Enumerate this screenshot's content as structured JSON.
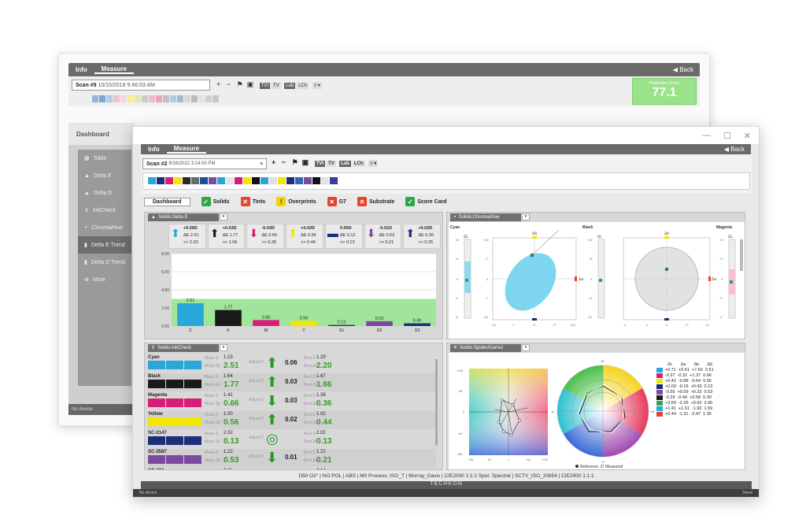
{
  "back_window": {
    "tabs": [
      "Info",
      "Measure"
    ],
    "back_label": "Back",
    "scan_label": "Scan #9",
    "scan_time": "10/15/2018 9:46:53 AM",
    "toolbar": [
      "+",
      "−",
      "TVI",
      "TV",
      "Lab",
      "LCh"
    ],
    "production_score_label": "Production Score",
    "production_score_value": "77.1",
    "dashboard_label": "Dashboard",
    "sidebar": [
      "Table",
      "Delta E",
      "Delta D",
      "InkCheck",
      "Chroma/Hue",
      "Delta E Trend",
      "Delta D Trend",
      "More"
    ],
    "status": "No device",
    "swatch_colors": [
      "#9ab4d8",
      "#7fa7d6",
      "#b6c9e6",
      "#f0c0d4",
      "#f4d6e2",
      "#f6ed9a",
      "#dfe9a8",
      "#c9c9c9",
      "#f2b9cc",
      "#e8a6bc",
      "#c0c0c0",
      "#b6c7e4",
      "#a8b8d8",
      "#d7d7d7",
      "#bcbcbc",
      "#e4e4e4",
      "#d0d0d0",
      "#c8c8c8"
    ]
  },
  "front_window": {
    "tabs": [
      "Info",
      "Measure"
    ],
    "back_label": "Back",
    "scan_label": "Scan #2",
    "scan_time": "8/16/2022 3:24:00 PM",
    "toolbar": [
      "+",
      "−",
      "TVI",
      "TV",
      "Lab",
      "LCh"
    ],
    "swatch_colors": [
      "#29a7d8",
      "#1c2e78",
      "#d61e78",
      "#f3e600",
      "#2a2a2a",
      "#6a6a6a",
      "#1a4f9c",
      "#7c4ba0",
      "#29a7d8",
      "#e3e3e3",
      "#d61e78",
      "#f3e600",
      "#111",
      "#29a7d8",
      "#e0e0e0",
      "#f3e600",
      "#1c2e78",
      "#2e6ab3",
      "#7c4ba0",
      "#111",
      "#e2e2e2",
      "#3a3aa0"
    ],
    "dash_tabs": [
      {
        "label": "Dashboard",
        "status": "none"
      },
      {
        "label": "Solids",
        "status": "ok"
      },
      {
        "label": "Tints",
        "status": "err"
      },
      {
        "label": "Overprints",
        "status": "warn"
      },
      {
        "label": "G7",
        "status": "err"
      },
      {
        "label": "Substrate",
        "status": "err"
      },
      {
        "label": "Score Card",
        "status": "ok"
      }
    ],
    "panels": {
      "delta_e_title": "Solids:Delta E",
      "chroma_title": "Solids:Chroma/Hue",
      "inkcheck_title": "Solids:InkCheck",
      "spider_title": "Solids:Spider/Gamut"
    },
    "delta_tiles": [
      {
        "d": "+0.06D",
        "de": "ΔE 2.51",
        "t": ">> 2.20",
        "color": "#29a7d8",
        "dir": "up"
      },
      {
        "d": "+0.03D",
        "de": "ΔE 1.77",
        "t": ">> 1.66",
        "color": "#1a1a1a",
        "dir": "up"
      },
      {
        "d": "-0.03D",
        "de": "ΔE 0.66",
        "t": ">> 0.36",
        "color": "#d61e78",
        "dir": "down"
      },
      {
        "d": "+0.02D",
        "de": "ΔE 0.56",
        "t": ">> 0.44",
        "color": "#f3e600",
        "dir": "up"
      },
      {
        "d": "0.00D",
        "de": "ΔE 0.12",
        "t": ">> 0.13",
        "color": "#1c2e78",
        "dir": "none"
      },
      {
        "d": "-0.01D",
        "de": "ΔE 0.53",
        "t": ">> 0.21",
        "color": "#7c4ba0",
        "dir": "down"
      },
      {
        "d": "+0.03D",
        "de": "ΔE 0.30",
        "t": ">> 0.26",
        "color": "#1c2e78",
        "dir": "up"
      }
    ],
    "chroma": {
      "labels": [
        "Cyan",
        "Black",
        "Magenta"
      ],
      "left_ticks": [
        "+14",
        "+7",
        "0",
        "-7",
        "-14"
      ],
      "bottom_ticks_1": [
        "-14",
        "-7",
        "0",
        "+7",
        "+14"
      ],
      "bottom_ticks_2": [
        "-4",
        "-2",
        "0",
        "+2",
        "+4"
      ],
      "side_ticks_1": [
        "+8",
        "+4",
        "0",
        "-4",
        "-8"
      ],
      "side_ticks_2": [
        "+12",
        "+6",
        "0",
        "-6",
        "-12"
      ],
      "side_ticks_3": [
        "+4",
        "+2",
        "0",
        "-2",
        "-4"
      ],
      "dl": "ΔL",
      "db": "Δb",
      "da": "Δa"
    },
    "inkcheck": [
      {
        "name": "Cyan",
        "colors": [
          "#29a7d8",
          "#29a7d8",
          "#29a7d8"
        ],
        "meas_d": "1.23",
        "meas_de": "2.51",
        "adjust": "0.06",
        "dir": "up",
        "best_d": "1.29",
        "best_de": "2.20"
      },
      {
        "name": "Black",
        "colors": [
          "#1a1a1a",
          "#1a1a1a",
          "#1a1a1a"
        ],
        "meas_d": "1.64",
        "meas_de": "1.77",
        "adjust": "0.03",
        "dir": "up",
        "best_d": "1.67",
        "best_de": "1.66"
      },
      {
        "name": "Magenta",
        "colors": [
          "#d61e78",
          "#d61e78",
          "#d61e78"
        ],
        "meas_d": "1.41",
        "meas_de": "0.66",
        "adjust": "0.03",
        "dir": "down",
        "best_d": "1.38",
        "best_de": "0.36"
      },
      {
        "name": "Yellow",
        "colors": [
          "#f3e600",
          "#f3e600",
          "#f3e600"
        ],
        "meas_d": "1.00",
        "meas_de": "0.56",
        "adjust": "0.02",
        "dir": "up",
        "best_d": "1.02",
        "best_de": "0.44"
      },
      {
        "name": "SC-2147",
        "colors": [
          "#1c2e78",
          "#1c2e78",
          "#1c2e78"
        ],
        "meas_d": "2.02",
        "meas_de": "0.13",
        "adjust": "",
        "dir": "target",
        "best_d": "2.02",
        "best_de": "0.13"
      },
      {
        "name": "SC-2587",
        "colors": [
          "#7c4ba0",
          "#7c4ba0",
          "#7c4ba0"
        ],
        "meas_d": "1.22",
        "meas_de": "0.53",
        "adjust": "0.01",
        "dir": "down",
        "best_d": "1.21",
        "best_de": "0.21"
      },
      {
        "name": "SC-274",
        "colors": [],
        "meas_d": "2.11",
        "meas_de": "",
        "adjust": "",
        "dir": "none",
        "best_d": "2.14",
        "best_de": ""
      }
    ],
    "ink_labels": {
      "meas_d": "Meas D",
      "meas_de": "Meas ΔE",
      "adjust": "Adjust D",
      "best_d": "Best D",
      "best_de": "Best ΔE"
    },
    "spider": {
      "legend_header": [
        "ΔL",
        "Δa",
        "Δb",
        "ΔE"
      ],
      "legend_rows": [
        {
          "color": "#29a7d8",
          "vals": "+0.71  +0.61  +7.60  2.51"
        },
        {
          "color": "#d61e78",
          "vals": "-0.37  -0.32  +1.37  0.66"
        },
        {
          "color": "#f3e600",
          "vals": "+0.42  -0.88  -0.64  0.56"
        },
        {
          "color": "#1c2e78",
          "vals": "+0.03  -0.16  +0.43  0.13"
        },
        {
          "color": "#7c4ba0",
          "vals": "-0.56  +0.09  +0.23  0.53"
        },
        {
          "color": "#1a1a1a",
          "vals": "-0.29  -0.40  +0.58  0.30"
        },
        {
          "color": "#2ca84a",
          "vals": "+3.59  -2.25  +3.62  2.90"
        },
        {
          "color": "#29a7d8",
          "vals": "+1.41  +1.51  -1.92  1.59"
        },
        {
          "color": "#e2452b",
          "vals": "+0.44  -1.31  -3.47  1.35"
        }
      ],
      "ref_label": "Reference",
      "meas_label": "Measured",
      "axis_b_plus": "+b",
      "axis_b_minus": "-b",
      "axis_a_minus": "-a",
      "axis_a_plus": "+a",
      "grid_left_ticks": [
        "+128",
        "+96",
        "+64",
        "+32",
        "0",
        "-32",
        "-64",
        "-96",
        "-128"
      ],
      "grid_bottom_ticks": [
        "-128",
        "-96",
        "-64",
        "-32",
        "0",
        "+32",
        "+64",
        "+96",
        "+128"
      ]
    },
    "status_line": "D50 O2° | NO POL | ABS | M0  Process: ISO_T | Murray_Davis | CIE2000 1:1:1  Spot: Spectral | SCTV_ISO_20654 | CIE2000 1:1:1",
    "brand": "TECHKON",
    "footer_left": "No device",
    "footer_right": "Steve"
  },
  "chart_data": {
    "type": "bar",
    "title": "Solids:Delta E",
    "categories": [
      "C",
      "K",
      "M",
      "Y",
      "S1",
      "S2",
      "S3"
    ],
    "values": [
      2.51,
      1.77,
      0.66,
      0.56,
      0.12,
      0.53,
      0.3
    ],
    "colors": [
      "#29a7d8",
      "#1a1a1a",
      "#d61e78",
      "#f3e600",
      "#1c2e78",
      "#7c4ba0",
      "#1c2e78"
    ],
    "ylim": [
      0,
      8
    ],
    "yticks": [
      "8.00",
      "6.00",
      "4.00",
      "2.00",
      "0.00"
    ],
    "tolerance_band": 3.0
  }
}
